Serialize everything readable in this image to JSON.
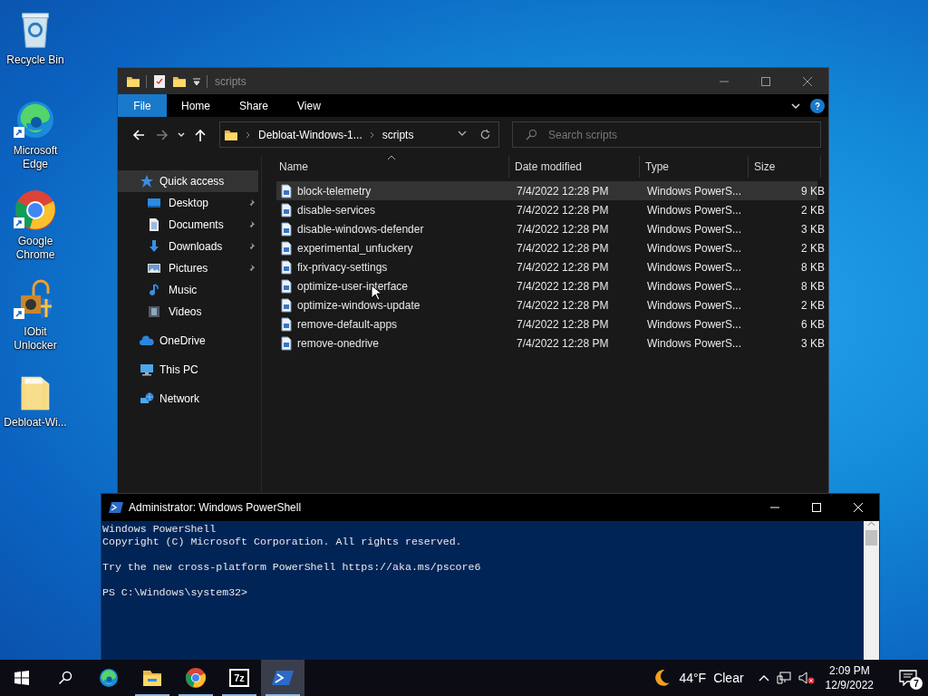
{
  "desktop_icons": [
    {
      "kind": "recycle-bin",
      "label": "Recycle Bin",
      "shortcut": false
    },
    {
      "kind": "edge",
      "label": "Microsoft Edge",
      "shortcut": true
    },
    {
      "kind": "chrome",
      "label": "Google Chrome",
      "shortcut": true
    },
    {
      "kind": "unlocker",
      "label": "IObit Unlocker",
      "shortcut": true
    },
    {
      "kind": "folder",
      "label": "Debloat-Wi...",
      "shortcut": false
    }
  ],
  "explorer": {
    "title": "scripts",
    "ribbon_tabs": [
      {
        "kind": "file",
        "label": "File"
      },
      {
        "kind": "tab",
        "label": "Home"
      },
      {
        "kind": "tab",
        "label": "Share"
      },
      {
        "kind": "tab",
        "label": "View"
      }
    ],
    "address": [
      "Debloat-Windows-1...",
      "scripts"
    ],
    "search": {
      "placeholder": "Search scripts"
    },
    "nav_pane": [
      {
        "kind": "star",
        "label": "Quick access",
        "selected": true,
        "children": [
          {
            "kind": "desktop",
            "label": "Desktop",
            "pinned": true,
            "selected": false
          },
          {
            "kind": "documents",
            "label": "Documents",
            "pinned": true,
            "selected": false
          },
          {
            "kind": "downloads",
            "label": "Downloads",
            "pinned": true,
            "selected": false
          },
          {
            "kind": "pictures",
            "label": "Pictures",
            "pinned": true,
            "selected": false
          },
          {
            "kind": "music",
            "label": "Music",
            "pinned": false,
            "selected": false
          },
          {
            "kind": "videos",
            "label": "Videos",
            "pinned": false,
            "selected": false
          }
        ]
      },
      {
        "kind": "cloud",
        "label": "OneDrive",
        "selected": false
      },
      {
        "kind": "pc",
        "label": "This PC",
        "selected": false
      },
      {
        "kind": "network",
        "label": "Network",
        "selected": false
      }
    ],
    "columns": [
      "Name",
      "Date modified",
      "Type",
      "Size"
    ],
    "rows": [
      {
        "name": "block-telemetry",
        "date": "7/4/2022 12:28 PM",
        "type": "Windows PowerS...",
        "size": "9 KB",
        "selected": true
      },
      {
        "name": "disable-services",
        "date": "7/4/2022 12:28 PM",
        "type": "Windows PowerS...",
        "size": "2 KB",
        "selected": false
      },
      {
        "name": "disable-windows-defender",
        "date": "7/4/2022 12:28 PM",
        "type": "Windows PowerS...",
        "size": "3 KB",
        "selected": false
      },
      {
        "name": "experimental_unfuckery",
        "date": "7/4/2022 12:28 PM",
        "type": "Windows PowerS...",
        "size": "2 KB",
        "selected": false
      },
      {
        "name": "fix-privacy-settings",
        "date": "7/4/2022 12:28 PM",
        "type": "Windows PowerS...",
        "size": "8 KB",
        "selected": false
      },
      {
        "name": "optimize-user-interface",
        "date": "7/4/2022 12:28 PM",
        "type": "Windows PowerS...",
        "size": "8 KB",
        "selected": false
      },
      {
        "name": "optimize-windows-update",
        "date": "7/4/2022 12:28 PM",
        "type": "Windows PowerS...",
        "size": "2 KB",
        "selected": false
      },
      {
        "name": "remove-default-apps",
        "date": "7/4/2022 12:28 PM",
        "type": "Windows PowerS...",
        "size": "6 KB",
        "selected": false
      },
      {
        "name": "remove-onedrive",
        "date": "7/4/2022 12:28 PM",
        "type": "Windows PowerS...",
        "size": "3 KB",
        "selected": false
      }
    ]
  },
  "console": {
    "title": "Administrator: Windows PowerShell",
    "paragraphs": [
      [
        "Windows PowerShell",
        "Copyright (C) Microsoft Corporation. All rights reserved."
      ],
      [
        "Try the new cross-platform PowerShell https://aka.ms/pscore6"
      ],
      [
        "PS C:\\Windows\\system32>"
      ]
    ]
  },
  "taskbar": {
    "apps": [
      {
        "kind": "edge",
        "running": false,
        "selected": false
      },
      {
        "kind": "explorer",
        "running": true,
        "selected": false
      },
      {
        "kind": "chrome",
        "running": true,
        "selected": false
      },
      {
        "kind": "sevenzip",
        "glyph": "7z",
        "running": true,
        "selected": false
      },
      {
        "kind": "powershell",
        "running": true,
        "selected": true
      }
    ],
    "weather": {
      "temperature": "44°F",
      "condition": "Clear"
    },
    "clock": {
      "time": "2:09 PM",
      "date": "12/9/2022"
    },
    "notifications": "7"
  }
}
